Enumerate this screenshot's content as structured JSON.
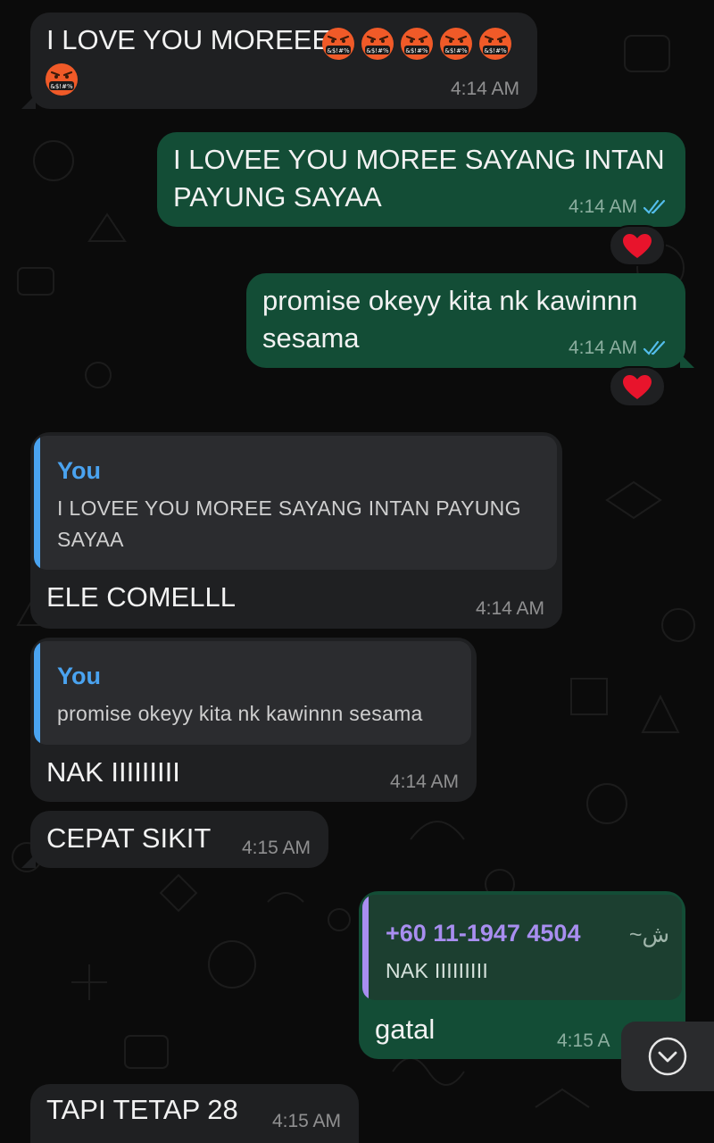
{
  "colors": {
    "incoming_bubble": "#1f2022",
    "outgoing_bubble": "#134d36",
    "read_ticks": "#53bdeb",
    "you_name": "#4aa3f0",
    "contact_name": "#a88ef0"
  },
  "messages": [
    {
      "direction": "incoming",
      "text_lines": [
        "I LOVE YOU MOREEE"
      ],
      "emoji": "angry-swearing-face",
      "emoji_count": 6,
      "time": "4:14 AM"
    },
    {
      "direction": "outgoing",
      "text_lines": [
        "I LOVEE YOU MOREE SAYANG INTAN",
        "PAYUNG SAYAA"
      ],
      "time": "4:14 AM",
      "status": "read",
      "reaction": "heart"
    },
    {
      "direction": "outgoing",
      "text_lines": [
        "promise okeyy kita nk kawinnn",
        "sesama"
      ],
      "time": "4:14 AM",
      "status": "read",
      "reaction": "heart"
    },
    {
      "direction": "incoming",
      "quote": {
        "author": "You",
        "text_lines": [
          "I LOVEE YOU MOREE SAYANG INTAN PAYUNG",
          "SAYAA"
        ]
      },
      "text": "ELE COMELLL",
      "time": "4:14 AM"
    },
    {
      "direction": "incoming",
      "quote": {
        "author": "You",
        "text": "promise okeyy kita nk kawinnn sesama"
      },
      "text": "NAK IIIIIIIII",
      "time": "4:14 AM"
    },
    {
      "direction": "incoming",
      "text": "CEPAT SIKIT",
      "time": "4:15 AM"
    },
    {
      "direction": "outgoing",
      "quote": {
        "author": "+60 11-1947 4504",
        "alias": "~ش",
        "text": "NAK IIIIIIIII"
      },
      "text": "gatal",
      "time": "4:15 A"
    },
    {
      "direction": "incoming",
      "text": "TAPI TETAP 28",
      "time": "4:15 AM"
    }
  ],
  "scroll_button": {
    "icon": "chevron-down-icon"
  }
}
